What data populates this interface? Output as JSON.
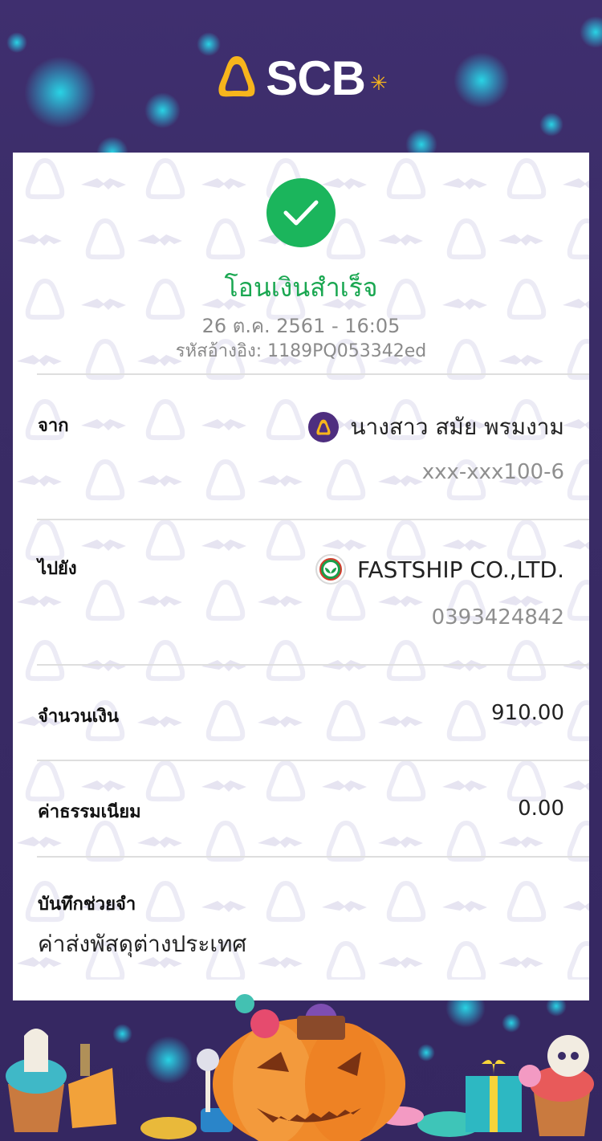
{
  "brand": {
    "logo_text": "SCB",
    "accent": "#4e2e7f",
    "gold": "#f7b51c"
  },
  "status": {
    "icon": "check-icon",
    "title": "โอนเงินสำเร็จ",
    "color": "#1aa751"
  },
  "transaction": {
    "datetime": "26 ต.ค. 2561 - 16:05",
    "reference": "รหัสอ้างอิง: 1189PQ053342ed"
  },
  "from": {
    "label": "จาก",
    "name": "นางสาว สมัย พรมงาม",
    "account": "xxx-xxx100-6",
    "bank_icon": "scb-bank-icon"
  },
  "to": {
    "label": "ไปยัง",
    "name": "FASTSHIP CO.,LTD.",
    "account": "0393424842",
    "bank_icon": "kbank-icon"
  },
  "amount": {
    "label": "จำนวนเงิน",
    "value": "910.00"
  },
  "fee": {
    "label": "ค่าธรรมเนียม",
    "value": "0.00"
  },
  "memo": {
    "label": "บันทึกช่วยจำ",
    "value": "ค่าส่งพัสดุต่างประเทศ"
  }
}
